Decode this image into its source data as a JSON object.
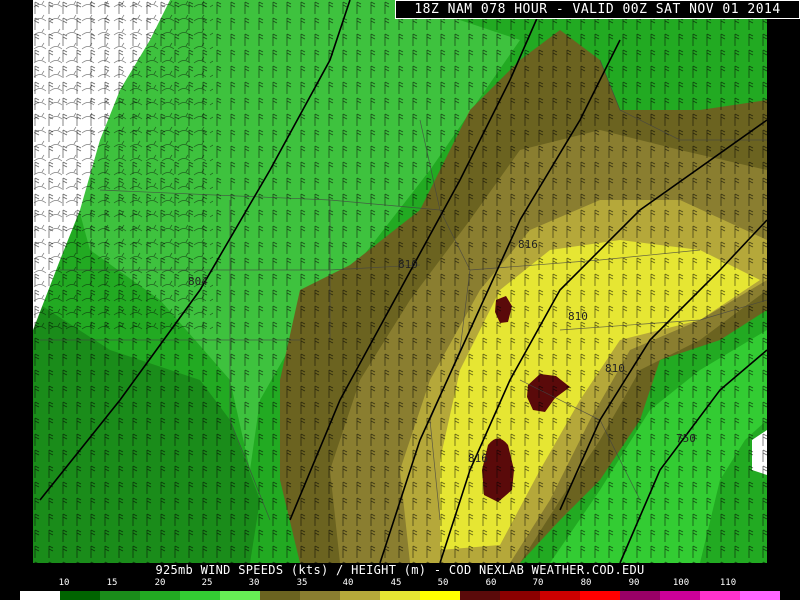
{
  "header": {
    "title": "18Z NAM 078 HOUR - VALID 00Z SAT NOV 01 2014"
  },
  "footer": {
    "caption": "925mb WIND SPEEDS (kts) / HEIGHT (m) - COD NEXLAB   WEATHER.COD.EDU"
  },
  "map": {
    "height_contour_labels": [
      "804",
      "810",
      "816",
      "810",
      "810",
      "816",
      "750"
    ]
  },
  "legend": {
    "scale_labels": [
      "10",
      "15",
      "20",
      "25",
      "30",
      "35",
      "40",
      "45",
      "50",
      "60",
      "70",
      "80",
      "90",
      "100",
      "110"
    ],
    "scale_colors": [
      "#ffffff",
      "#006400",
      "#1a8c1a",
      "#22aa22",
      "#33cc33",
      "#66ee55",
      "#6b6320",
      "#8a7e30",
      "#b5a83a",
      "#e6e633",
      "#ffff00",
      "#5a0a0a",
      "#8b0000",
      "#cc0000",
      "#ff0000",
      "#990066",
      "#cc0099",
      "#ff33cc",
      "#ff66ff"
    ]
  }
}
